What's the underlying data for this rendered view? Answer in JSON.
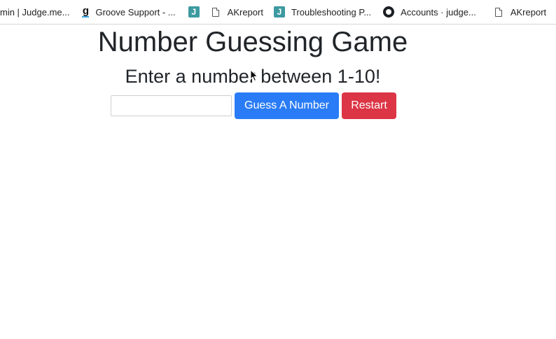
{
  "bookmarks": [
    {
      "label": "min | Judge.me...",
      "icon": "none"
    },
    {
      "label": "Groove Support - ...",
      "icon": "groove-icon"
    },
    {
      "label": "",
      "icon": "j-icon",
      "glyph": "J"
    },
    {
      "label": "AKreport",
      "icon": "page-icon"
    },
    {
      "label": "Troubleshooting P...",
      "icon": "j-icon",
      "glyph": "J"
    },
    {
      "label": "Accounts · judge...",
      "icon": "github-icon"
    },
    {
      "label": "AKreport",
      "icon": "page-icon"
    }
  ],
  "game": {
    "title": "Number Guessing Game",
    "subtitle": "Enter a number between 1-10!",
    "input_value": "",
    "guess_button": "Guess A Number",
    "restart_button": "Restart"
  },
  "colors": {
    "primary": "#2a7cf6",
    "danger": "#dc3545",
    "text": "#212529"
  }
}
